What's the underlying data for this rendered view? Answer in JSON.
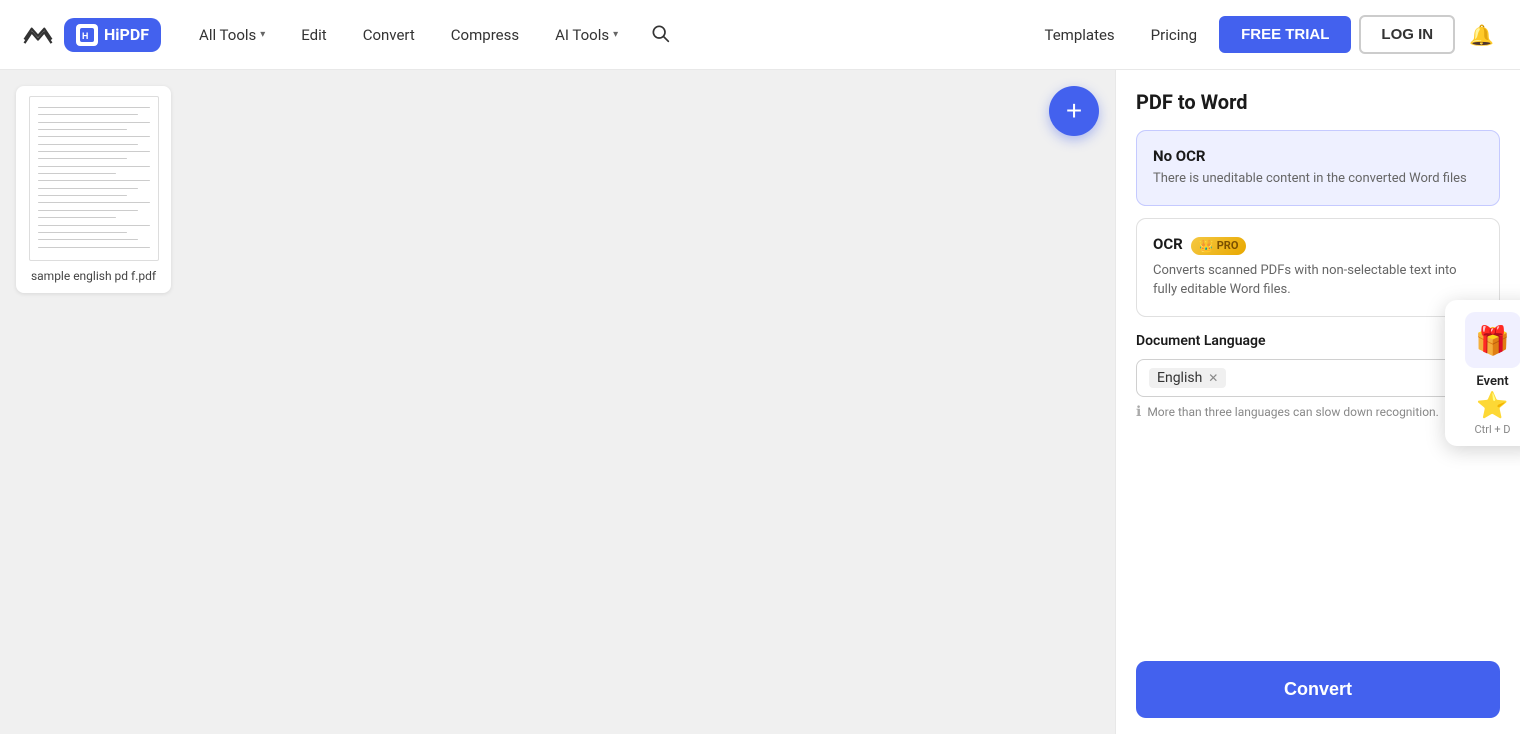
{
  "navbar": {
    "brand": "HiPDF",
    "nav_items": [
      {
        "label": "All Tools",
        "has_arrow": true
      },
      {
        "label": "Edit",
        "has_arrow": false
      },
      {
        "label": "Convert",
        "has_arrow": false
      },
      {
        "label": "Compress",
        "has_arrow": false
      },
      {
        "label": "AI Tools",
        "has_arrow": true
      }
    ],
    "templates_label": "Templates",
    "pricing_label": "Pricing",
    "free_trial_label": "FREE TRIAL",
    "login_label": "LOG IN"
  },
  "main_panel": {
    "add_button_label": "+",
    "file": {
      "name": "sample english pd\nf.pdf"
    }
  },
  "right_panel": {
    "title": "PDF to Word",
    "no_ocr": {
      "title": "No OCR",
      "description": "There is uneditable content in the converted Word files"
    },
    "ocr": {
      "title": "OCR",
      "pro_label": "PRO",
      "description": "Converts scanned PDFs with non-selectable text into fully editable Word files."
    },
    "document_language": {
      "label": "Document Language",
      "selected_language": "English",
      "hint": "More than three languages can slow down recognition."
    },
    "convert_button": "Convert",
    "tooltip": {
      "label": "Event",
      "shortcut": "Ctrl + D"
    }
  }
}
